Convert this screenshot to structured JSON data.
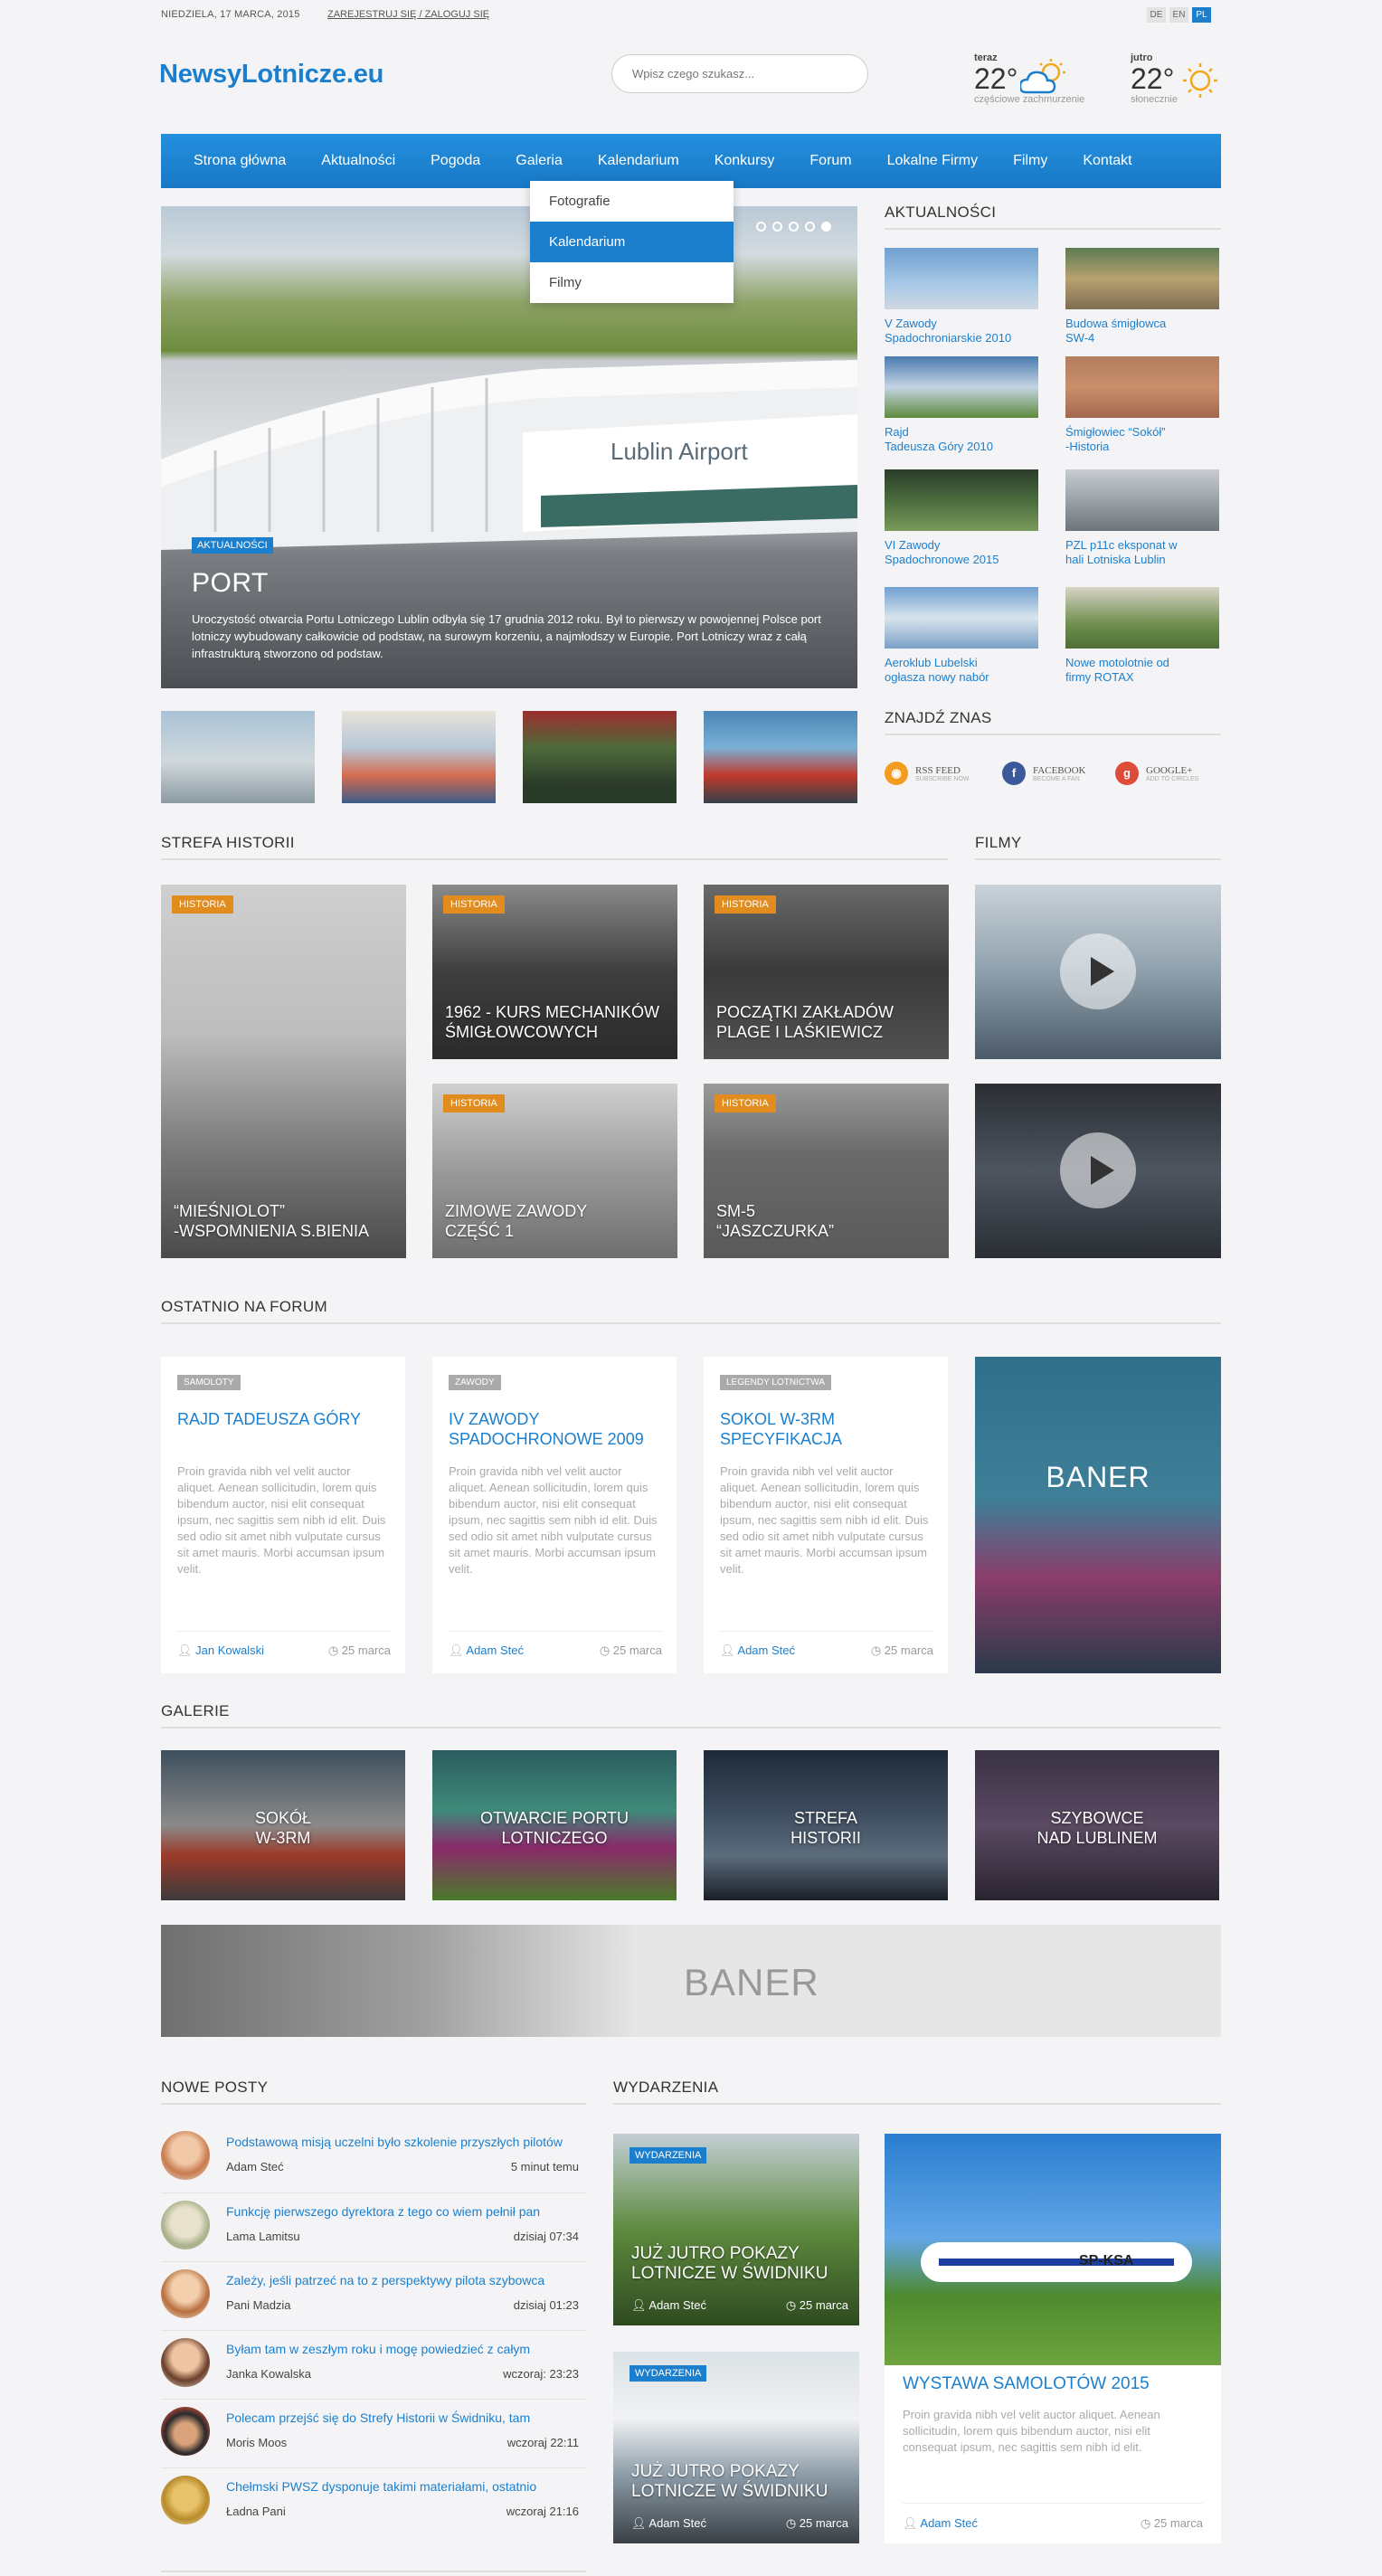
{
  "topbar": {
    "date": "NIEDZIELA, 17 MARCA, 2015",
    "auth": "ZAREJESTRUJ SIĘ / ZALOGUJ SIĘ",
    "langs": [
      "DE",
      "EN",
      "PL"
    ]
  },
  "header": {
    "logo": "NewsyLotnicze.eu",
    "search_placeholder": "Wpisz czego szukasz..."
  },
  "weather": {
    "now": {
      "label": "teraz",
      "temp": "22°",
      "desc": "częściowe zachmurzenie"
    },
    "tomorrow": {
      "label": "jutro",
      "temp": "22°",
      "desc": "słonecznie"
    }
  },
  "nav": [
    "Strona główna",
    "Aktualności",
    "Pogoda",
    "Galeria",
    "Kalendarium",
    "Konkursy",
    "Forum",
    "Lokalne Firmy",
    "Filmy",
    "Kontakt"
  ],
  "dropdown": [
    "Fotografie",
    "Kalendarium",
    "Filmy"
  ],
  "slider": {
    "tag": "AKTUALNOŚCI",
    "title": "PORT",
    "text": "Uroczystość otwarcia Portu Lotniczego Lublin odbyła się 17 grudnia 2012 roku. Był to pierwszy w powojennej Polsce port lotniczy wybudowany całkowicie od podstaw, na surowym korzeniu, a najmłodszy w Europie. Port Lotniczy wraz z całą infrastrukturą stworzono od podstaw.",
    "airport_sign": "Lublin Airport"
  },
  "aktualnosci": {
    "title": "AKTUALNOŚCI",
    "items": [
      "V Zawody\nSpadochroniarskie 2010",
      "Budowa śmigłowca\nSW-4",
      "Rajd\nTadeusza Góry 2010",
      "Śmigłowiec “Sokół”\n-Historia",
      "VI Zawody\nSpadochronowe 2015",
      "PZL p11c eksponat w\nhali Lotniska Lublin",
      "Aeroklub Lubelski\nogłasza nowy nabór",
      "Nowe motolotnie od\nfirmy ROTAX"
    ]
  },
  "znajdz": {
    "title": "ZNAJDŹ ZNAS",
    "items": [
      {
        "name": "RSS FEED",
        "sub": "SUBSCRIBE NOW"
      },
      {
        "name": "FACEBOOK",
        "sub": "BECOME A FAN"
      },
      {
        "name": "GOOGLE+",
        "sub": "ADD TO CIRCLES"
      }
    ]
  },
  "historia": {
    "title": "STREFA HISTORII",
    "tag": "HISTORIA",
    "items": [
      "“MIEŚNIOLOT”\n-WSPOMNIENIA S.BIENIA",
      "1962 - KURS MECHANIKÓW\nŚMIGŁOWCOWYCH",
      "POCZĄTKI ZAKŁADÓW\nPLAGE I LAŚKIEWICZ",
      "ZIMOWE ZAWODY\nCZĘŚĆ 1",
      "SM-5\n“JASZCZURKA”"
    ]
  },
  "filmy": {
    "title": "FILMY"
  },
  "forum": {
    "title": "OSTATNIO NA FORUM",
    "lorem": "Proin gravida nibh vel velit auctor aliquet. Aenean sollicitudin, lorem quis bibendum auctor, nisi elit consequat ipsum, nec sagittis sem nibh id elit. Duis sed odio sit amet nibh vulputate cursus sit amet mauris. Morbi accumsan ipsum velit.",
    "cards": [
      {
        "tag": "SAMOLOTY",
        "title": "RAJD TADEUSZA GÓRY",
        "author": "Jan Kowalski",
        "date": "25 marca"
      },
      {
        "tag": "ZAWODY",
        "title": "IV ZAWODY SPADOCHRONOWE 2009",
        "author": "Adam Steć",
        "date": "25 marca"
      },
      {
        "tag": "LEGENDY LOTNICTWA",
        "title": "SOKOL W-3RM SPECYFIKACJA",
        "author": "Adam Steć",
        "date": "25 marca"
      }
    ],
    "banner": "BANER"
  },
  "galerie": {
    "title": "GALERIE",
    "items": [
      "SOKÓŁ\nW-3RM",
      "OTWARCIE PORTU\nLOTNICZEGO",
      "STREFA\nHISTORII",
      "SZYBOWCE\nNAD LUBLINEM"
    ]
  },
  "banner_wide": "BANER",
  "posty": {
    "title": "NOWE POSTY",
    "items": [
      {
        "title": "Podstawową misją uczelni było szkolenie przyszłych pilotów",
        "author": "Adam Steć",
        "time": "5 minut temu"
      },
      {
        "title": "Funkcję pierwszego dyrektora z tego co wiem pełnił pan",
        "author": "Lama Lamitsu",
        "time": "dzisiaj 07:34"
      },
      {
        "title": "Zależy, jeśli patrzeć na to z perspektywy pilota szybowca",
        "author": "Pani Madzia",
        "time": "dzisiaj 01:23"
      },
      {
        "title": "Byłam tam w zeszłym roku i mogę powiedzieć z całym",
        "author": "Janka Kowalska",
        "time": "wczoraj: 23:23"
      },
      {
        "title": "Polecam przejść się do Strefy Historii w Świdniku, tam",
        "author": "Moris Moos",
        "time": "wczoraj 22:11"
      },
      {
        "title": "Chełmski PWSZ dysponuje takimi materiałami, ostatnio",
        "author": "Ładna Pani",
        "time": "wczoraj 21:16"
      }
    ]
  },
  "wydarzenia": {
    "title": "WYDARZENIA",
    "tag": "WYDARZENIA",
    "items": [
      {
        "title": "JUŻ JUTRO POKAZY\nLOTNICZE W ŚWIDNIKU",
        "author": "Adam Steć",
        "date": "25 marca"
      },
      {
        "title": "JUŻ JUTRO POKAZY\nLOTNICZE W ŚWIDNIKU",
        "author": "Adam Steć",
        "date": "25 marca"
      }
    ],
    "feature": {
      "title": "WYSTAWA SAMOLOTÓW 2015",
      "text": "Proin gravida nibh vel velit auctor aliquet. Aenean sollicitudin, lorem quis bibendum auctor, nisi elit consequat ipsum, nec sagittis sem nibh id elit.",
      "author": "Adam Steć",
      "date": "25 marca",
      "reg": "SP-KSA"
    }
  }
}
